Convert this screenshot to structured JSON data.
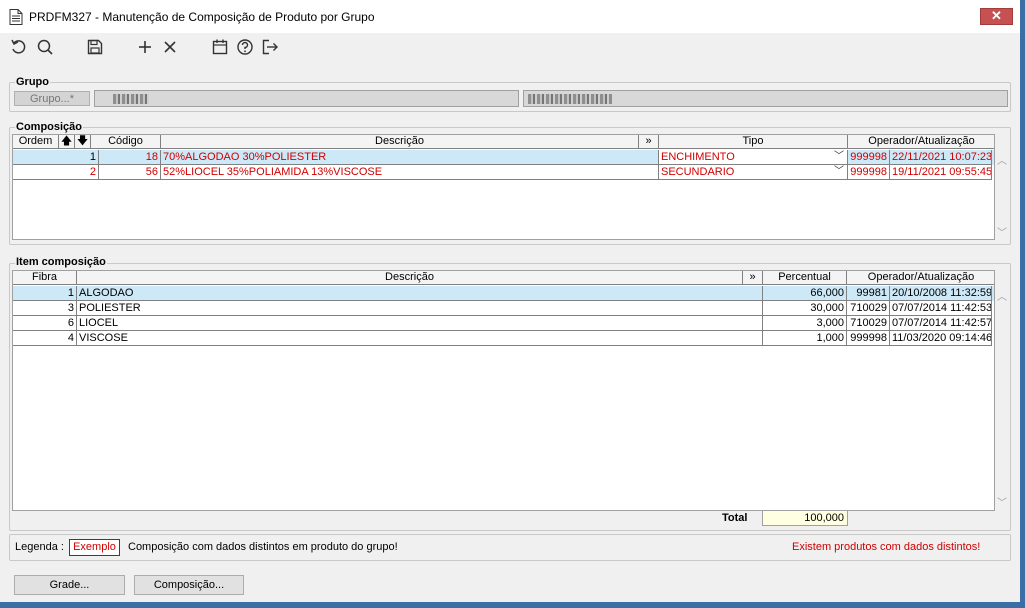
{
  "window": {
    "title": "PRDFM327 - Manutenção de Composição de Produto por Grupo",
    "close": "✕"
  },
  "toolbar": {
    "icons": [
      "undo-icon",
      "search-icon",
      "save-icon",
      "add-icon",
      "delete-icon",
      "calendar-icon",
      "help-icon",
      "exit-icon"
    ]
  },
  "grupo": {
    "section_label": "Grupo",
    "button_label": "Grupo...*"
  },
  "composicao": {
    "section_label": "Composição",
    "headers": {
      "ordem": "Ordem",
      "up": "🡅",
      "down": "🡇",
      "codigo": "Código",
      "descricao": "Descrição",
      "expand": "»",
      "tipo": "Tipo",
      "operador": "Operador/Atualização"
    },
    "rows": [
      {
        "ordem": "1",
        "codigo": "18",
        "descricao": "70%ALGODAO 30%POLIESTER",
        "tipo": "ENCHIMENTO",
        "operador": "999998",
        "data": "22/11/2021 10:07:23"
      },
      {
        "ordem": "2",
        "codigo": "56",
        "descricao": "52%LIOCEL 35%POLIAMIDA 13%VISCOSE",
        "tipo": "SECUNDARIO",
        "operador": "999998",
        "data": "19/11/2021 09:55:45"
      }
    ]
  },
  "item": {
    "section_label": "Item composição",
    "headers": {
      "fibra": "Fibra",
      "descricao": "Descrição",
      "expand": "»",
      "percentual": "Percentual",
      "operador": "Operador/Atualização"
    },
    "rows": [
      {
        "fibra": "1",
        "descricao": "ALGODAO",
        "percentual": "66,000",
        "operador": "99981",
        "data": "20/10/2008 11:32:59"
      },
      {
        "fibra": "3",
        "descricao": "POLIESTER",
        "percentual": "30,000",
        "operador": "710029",
        "data": "07/07/2014 11:42:53"
      },
      {
        "fibra": "6",
        "descricao": "LIOCEL",
        "percentual": "3,000",
        "operador": "710029",
        "data": "07/07/2014 11:42:57"
      },
      {
        "fibra": "4",
        "descricao": "VISCOSE",
        "percentual": "1,000",
        "operador": "999998",
        "data": "11/03/2020 09:14:46"
      }
    ],
    "total_label": "Total",
    "total_value": "100,000"
  },
  "legend": {
    "label": "Legenda :",
    "example": "Exemplo",
    "text": "Composição com dados distintos em produto do grupo!",
    "warning": "Existem produtos com dados distintos!"
  },
  "buttons": {
    "grade": "Grade...",
    "composicao": "Composição..."
  },
  "colors": {
    "accent_red": "#d00000",
    "selected_row": "#cde8f6",
    "total_bg": "#ffffe1"
  }
}
